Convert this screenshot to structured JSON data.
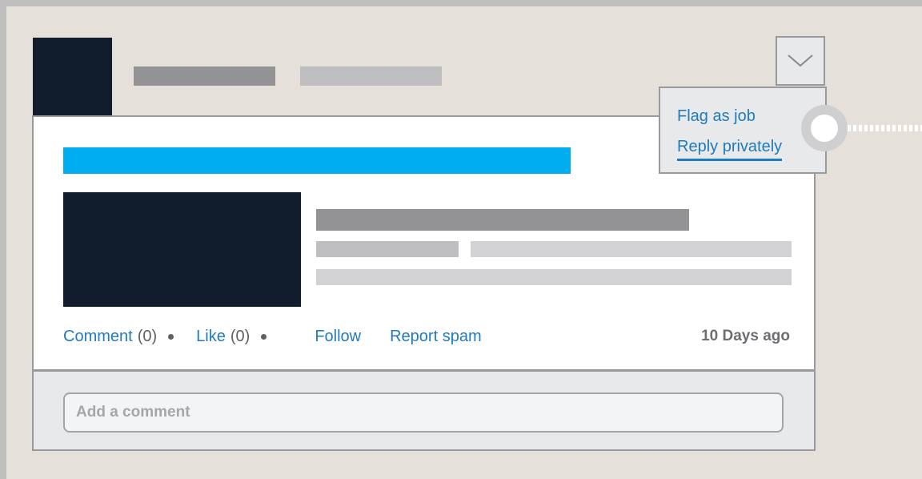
{
  "post": {
    "actions": {
      "comment_label": "Comment",
      "comment_count": "(0)",
      "like_label": "Like",
      "like_count": "(0)",
      "follow_label": "Follow",
      "report_label": "Report spam",
      "timestamp": "10 Days ago"
    }
  },
  "comment_box": {
    "placeholder": "Add a comment"
  },
  "dropdown_menu": {
    "items": [
      {
        "label": "Flag as job"
      },
      {
        "label": "Reply privately"
      }
    ]
  },
  "icons": {
    "dropdown": "chevron-down-icon",
    "pointer": "pointer-indicator-icon"
  },
  "colors": {
    "accent": "#00adef",
    "link": "#1f7bbd",
    "dark_block": "#111c2d"
  }
}
